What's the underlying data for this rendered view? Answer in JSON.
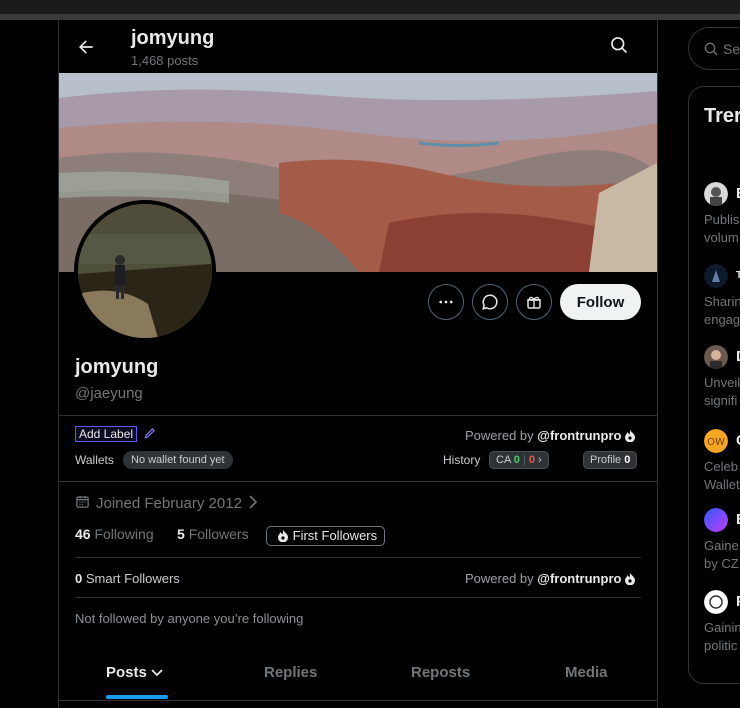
{
  "header": {
    "name": "jomyung",
    "posts": "1,468 posts"
  },
  "profile": {
    "name": "jomyung",
    "handle": "@jaeyung",
    "follow_label": "Follow",
    "joined": "Joined February 2012",
    "following_count": "46",
    "following_label": "Following",
    "followers_count": "5",
    "followers_label": "Followers"
  },
  "extension": {
    "add_label": "Add Label",
    "powered_prefix": "Powered by",
    "powered_brand": "@frontrunpro",
    "wallets_label": "Wallets",
    "wallets_value": "No wallet found yet",
    "history_label": "History",
    "ca_label": "CA",
    "ca_green": "0",
    "ca_red": "0",
    "profile_label": "Profile",
    "profile_value": "0",
    "first_followers": "First Followers",
    "smart_count": "0",
    "smart_label": "Smart Followers",
    "not_followed": "Not followed by anyone you’re following"
  },
  "tabs": [
    {
      "label": "Posts",
      "active": true
    },
    {
      "label": "Replies",
      "active": false
    },
    {
      "label": "Reposts",
      "active": false
    },
    {
      "label": "Media",
      "active": false
    }
  ],
  "sidebar": {
    "search_placeholder": "Sea",
    "trends_title": "Trer",
    "items": [
      {
        "letter": "B",
        "line1": "Publis",
        "line2": "volum"
      },
      {
        "letter": "T",
        "line1": "Sharin",
        "line2": "engag"
      },
      {
        "letter": "D",
        "line1": "Unveil",
        "line2": "signifi"
      },
      {
        "letter": "C",
        "line1": "Celeb",
        "line2": "Wallet"
      },
      {
        "letter": "B",
        "line1": "Gaine",
        "line2": "by CZ"
      },
      {
        "letter": "P",
        "line1": "Gainin",
        "line2": "politic"
      }
    ]
  },
  "colors": {
    "accent": "#1d9bf0",
    "follow_bg": "#eff3f4",
    "label_border": "#5b5bff"
  }
}
